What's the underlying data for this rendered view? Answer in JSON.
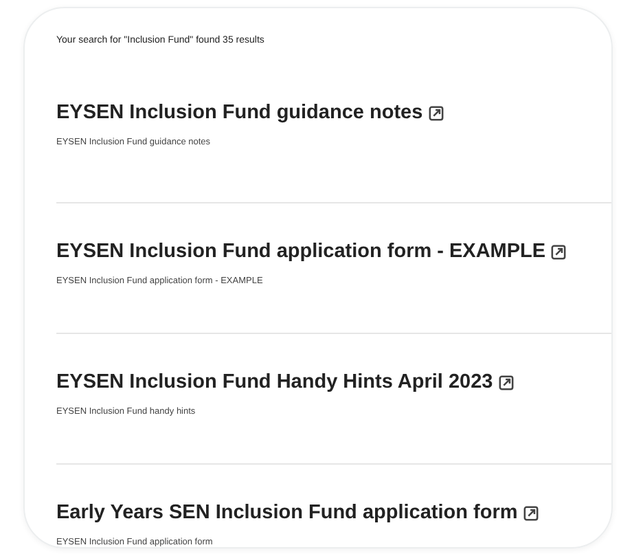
{
  "summary": "Your search for \"Inclusion Fund\" found 35 results",
  "results": [
    {
      "title": "EYSEN Inclusion Fund guidance notes",
      "external": true,
      "description": "EYSEN Inclusion Fund guidance notes"
    },
    {
      "title": "EYSEN Inclusion Fund application form - EXAMPLE",
      "external": true,
      "description": "EYSEN Inclusion Fund application form - EXAMPLE"
    },
    {
      "title": "EYSEN Inclusion Fund Handy Hints April 2023",
      "external": true,
      "description": "EYSEN Inclusion Fund handy hints"
    },
    {
      "title": "Early Years SEN Inclusion Fund application form",
      "external": true,
      "description": "EYSEN Inclusion Fund application form"
    }
  ]
}
